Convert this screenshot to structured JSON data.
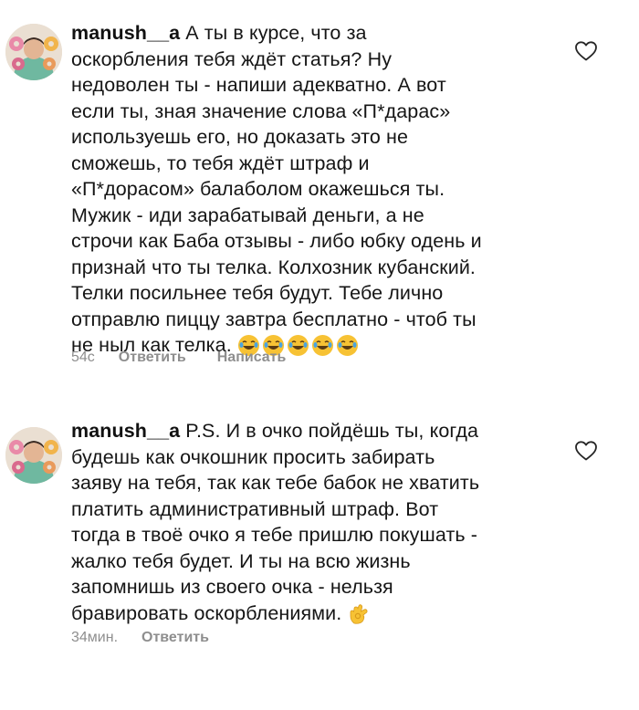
{
  "comments": [
    {
      "username": "manush__a",
      "text": " А ты в курсе, что за\nоскорбления тебя ждёт статья? Ну\nнедоволен ты - напиши адекватно. А вот\nесли ты, зная значение слова «П*дарас»\nиспользуешь его, но доказать это не\nсможешь, то тебя ждёт штраф и\n«П*дорасом» балаболом окажешься ты.\nМужик - иди зарабатывай деньги, а не\nстрочи как Баба отзывы - либо юбку одень и\nпризнай что ты телка. Колхозник кубанский.\nТелки посильнее тебя будут. Тебе лично\nотправлю пиццу завтра бесплатно - чтоб ты\nне ныл как телка. ",
      "emojis": [
        "joy-emoji",
        "joy-emoji",
        "joy-emoji",
        "joy-emoji",
        "joy-emoji"
      ],
      "time": "54с",
      "reply_label": "Ответить",
      "message_label": "Написать",
      "like_icon": "heart-outline-icon"
    },
    {
      "username": "manush__a",
      "text": " P.S. И в очко пойдёшь ты, когда\nбудешь как очкошник просить забирать\nзаяву на тебя, так как тебе бабок не хватить\nплатить административный штраф. Вот\nтогда в твоё очко я тебе пришлю покушать -\nжалко тебя будет. И ты на всю жизнь\nзапомнишь из своего очка - нельзя\nбравировать оскорблениями. ",
      "emojis": [
        "ok-hand-emoji"
      ],
      "time": "34мин.",
      "reply_label": "Ответить",
      "like_icon": "heart-outline-icon"
    }
  ],
  "colors": {
    "text": "#151515",
    "meta": "#8e8e8e",
    "emoji_yellow": "#f7c234"
  }
}
